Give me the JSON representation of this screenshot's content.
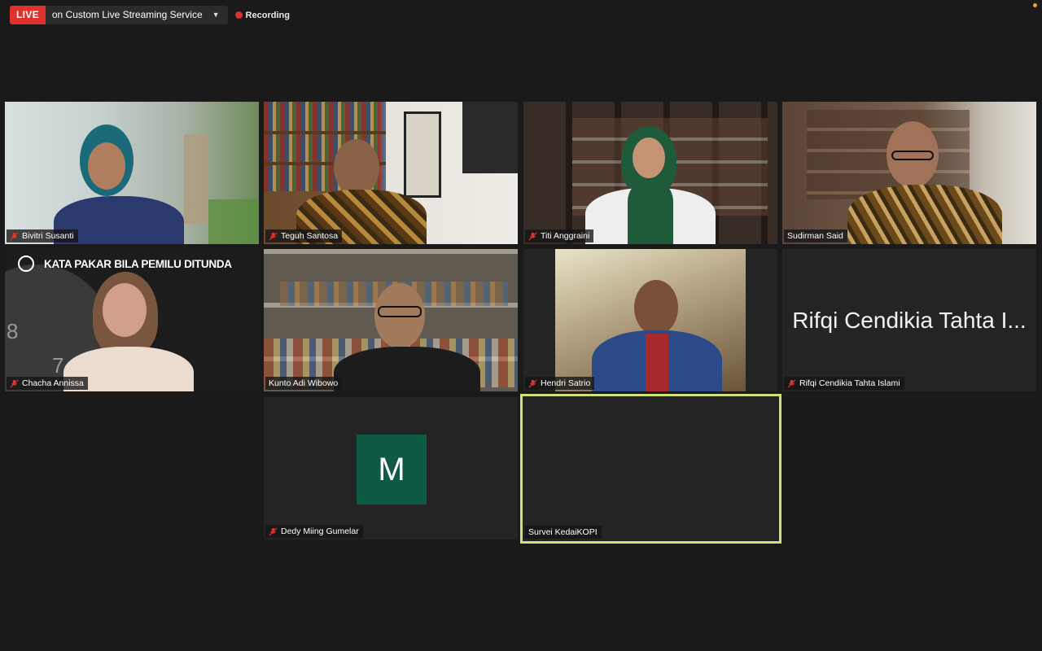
{
  "header": {
    "live_label": "LIVE",
    "stream_target": "on Custom Live Streaming Service",
    "recording_label": "Recording"
  },
  "colors": {
    "background": "#1a1a1a",
    "live_red": "#e0322d",
    "active_speaker_border": "#cfe27a",
    "avatar_green": "#0f5a45",
    "mute_red": "#e0322d"
  },
  "participants": [
    {
      "name": "Bivitri Susanti",
      "muted": true
    },
    {
      "name": "Teguh Santosa",
      "muted": true
    },
    {
      "name": "Titi Anggraini",
      "muted": true
    },
    {
      "name": "Sudirman Said",
      "muted": false
    },
    {
      "name": "Chacha Annissa",
      "muted": true,
      "overlay_title": "KATA PAKAR BILA PEMILU DITUNDA"
    },
    {
      "name": "Kunto Adi Wibowo",
      "muted": false
    },
    {
      "name": "Hendri Satrio",
      "muted": true
    },
    {
      "name": "Rifqi Cendikia Tahta Islami",
      "muted": true,
      "video_off_display": "Rifqi Cendikia Tahta I..."
    },
    {
      "name": "Dedy Miing Gumelar",
      "muted": true,
      "avatar_letter": "M"
    },
    {
      "name": "Survei KedaiKOPI",
      "muted": false,
      "active_speaker": true
    }
  ]
}
